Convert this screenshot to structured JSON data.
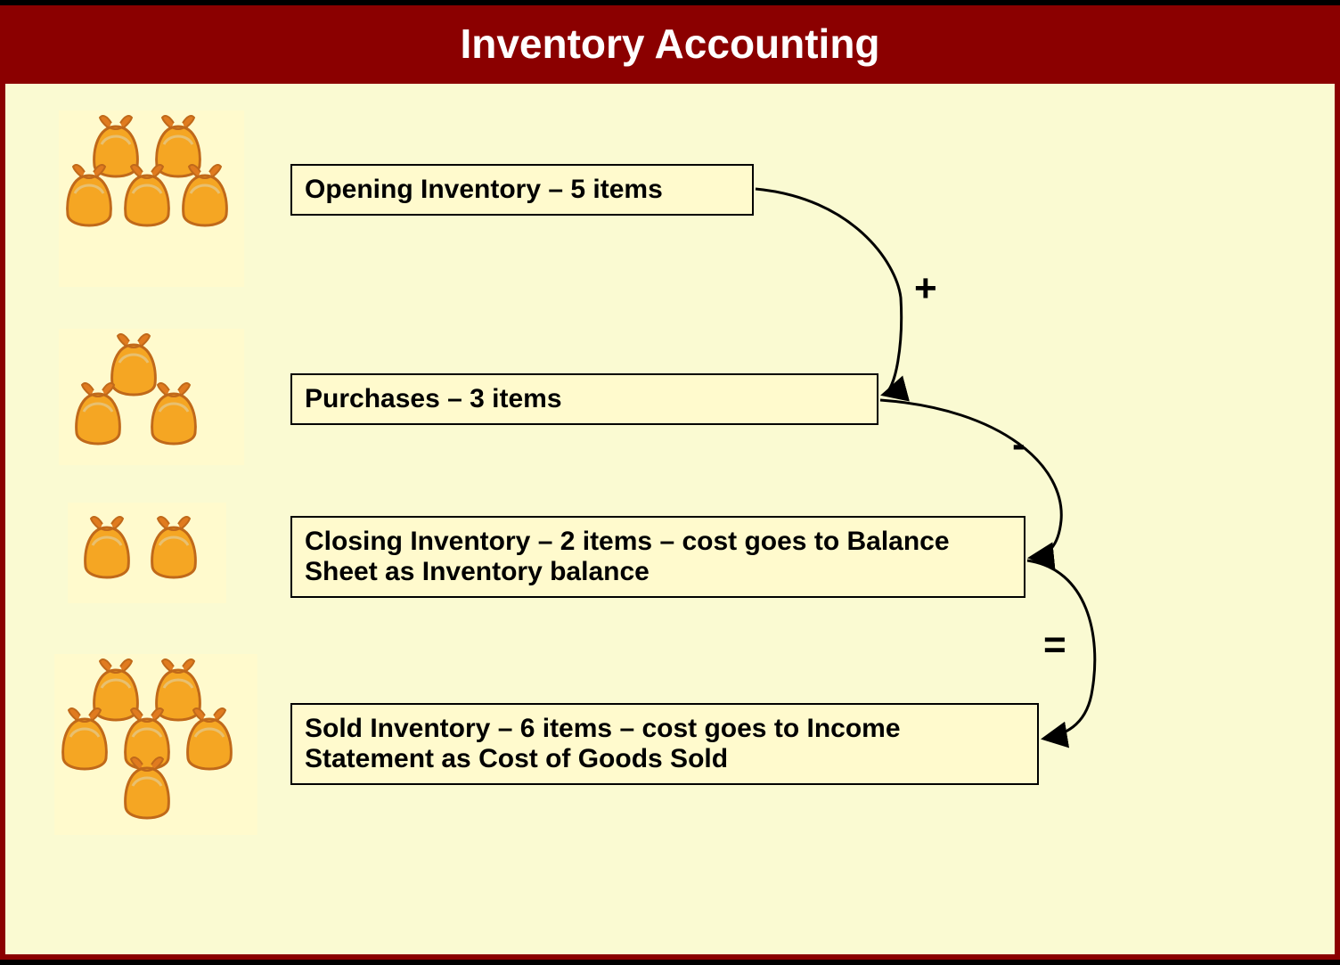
{
  "title": "Inventory Accounting",
  "rows": {
    "opening": {
      "label": "Opening Inventory – 5 items",
      "count": 5
    },
    "purchases": {
      "label": "Purchases – 3 items",
      "count": 3
    },
    "closing": {
      "label": "Closing Inventory – 2 items – cost goes to Balance Sheet as Inventory balance",
      "count": 2
    },
    "sold": {
      "label": "Sold Inventory – 6 items – cost goes to Income Statement as Cost of Goods Sold",
      "count": 6
    }
  },
  "operators": {
    "plus": "+",
    "minus": "-",
    "equals": "="
  },
  "colors": {
    "page_bg": "#fafad2",
    "box_bg": "#fffacd",
    "border": "#8b0000",
    "title_bg": "#8b0000",
    "title_fg": "#ffffff",
    "text": "#000000",
    "bag_fill": "#f5a623",
    "bag_stroke": "#d2691e"
  }
}
